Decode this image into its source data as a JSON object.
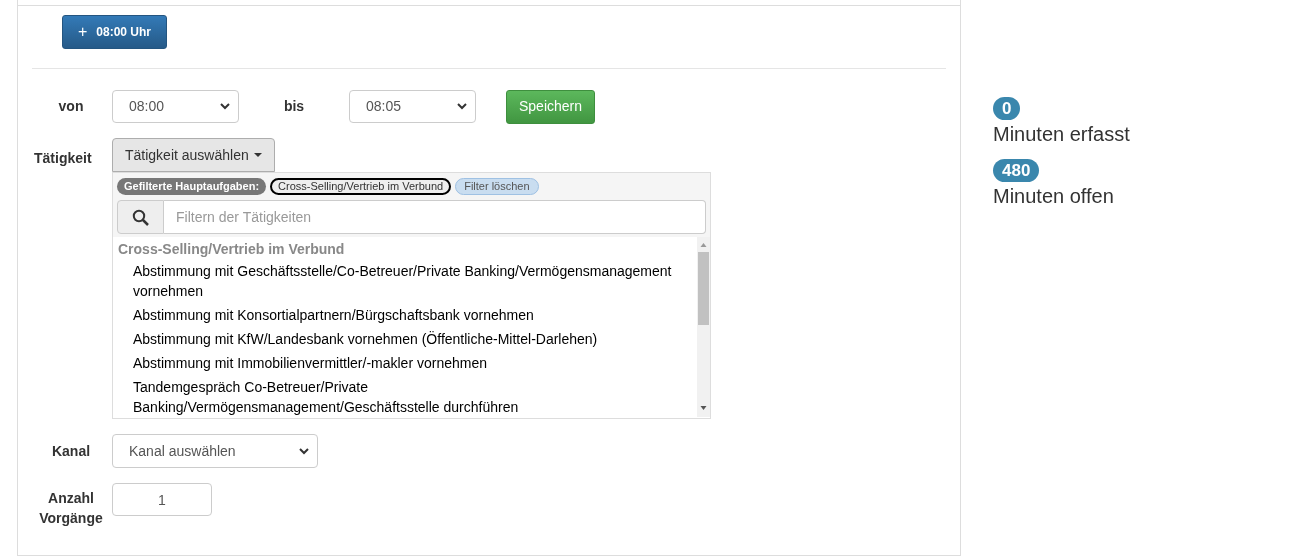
{
  "add_button": {
    "icon": "+",
    "label": "08:00 Uhr"
  },
  "von": {
    "label": "von",
    "value": "08:00"
  },
  "bis": {
    "label": "bis",
    "value": "08:05"
  },
  "save_button": "Speichern",
  "taetigkeit": {
    "label": "Tätigkeit",
    "dropdown": "Tätigkeit auswählen",
    "expanded": true,
    "filter_label": "Gefilterte Hauptaufgaben:",
    "filter_tags": [
      "Cross-Selling/Vertrieb im Verbund"
    ],
    "clear_filter": "Filter löschen",
    "search": {
      "placeholder": "Filtern der Tätigkeiten"
    },
    "groups": [
      {
        "label": "Cross-Selling/Vertrieb im Verbund",
        "children": [
          {
            "label": "Abstimmung mit Geschäftsstelle/Co-Betreuer/Private Banking/Vermögensmanagement vornehmen"
          },
          {
            "label": "Abstimmung mit Konsortialpartnern/Bürgschaftsbank vornehmen"
          },
          {
            "label": "Abstimmung mit KfW/Landesbank vornehmen (Öffentliche-Mittel-Darlehen)"
          },
          {
            "label": "Abstimmung mit Immobilienvermittler/-makler vornehmen"
          },
          {
            "label": "Tandemgespräch Co-Betreuer/Private Banking/Vermögensmanagement/Geschäftsstelle durchführen"
          }
        ]
      }
    ]
  },
  "kanal": {
    "label": "Kanal",
    "value": "Kanal auswählen"
  },
  "anzahl": {
    "label": "Anzahl Vorgänge",
    "value": "1"
  },
  "stats": [
    {
      "count": "0",
      "label": "Minuten erfasst"
    },
    {
      "count": "480",
      "label": "Minuten offen"
    }
  ]
}
